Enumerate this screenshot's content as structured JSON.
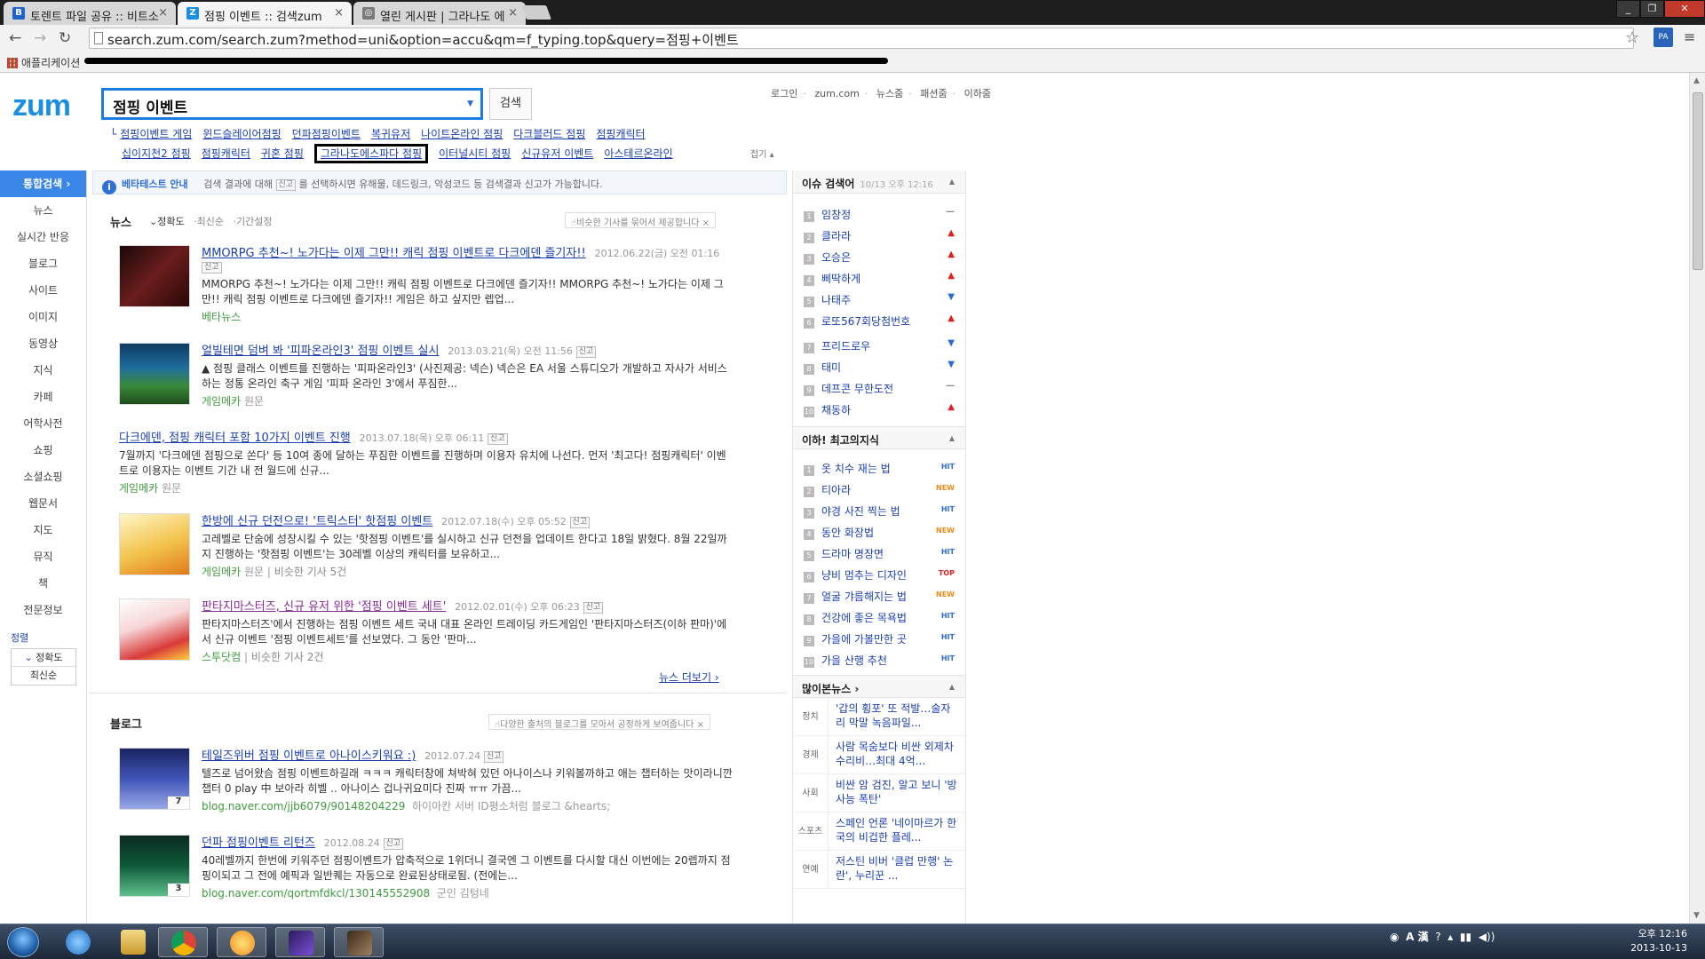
{
  "browser": {
    "tabs": [
      {
        "label": "토렌트 파일 공유 :: 비트소",
        "fav": "B",
        "color": "#1f64c8"
      },
      {
        "label": "점핑 이벤트 :: 검색zum",
        "fav": "Z",
        "color": "#1a8ee0"
      },
      {
        "label": "열린 게시판 | 그라나도 에",
        "fav": "◎",
        "color": "#7a7a7a"
      }
    ],
    "url": "search.zum.com/search.zum?method=uni&option=accu&qm=f_typing.top&query=점핑+이벤트",
    "bookmarks_apps": "애플리케이션",
    "ext_label": "PA"
  },
  "header": {
    "logo": "zum",
    "query": "점핑 이벤트",
    "search_button": "검색",
    "top_links": [
      "로그인",
      "zum.com",
      "뉴스줌",
      "패션줌",
      "이하줌"
    ]
  },
  "related": {
    "row1": [
      "점핑이벤트 게임",
      "윈드슬레이어점핑",
      "던파점핑이벤트",
      "복귀유저",
      "나이트온라인 점핑",
      "다크블러드 점핑",
      "점핑캐릭터"
    ],
    "row2": [
      "십이지천2 점핑",
      "점핑캐릭터",
      "귀혼 점핑",
      "그라나도에스파다 점핑",
      "이터널시티 점핑",
      "신규유저 이벤트",
      "아스테르온라인"
    ],
    "fold": "접기 ▴"
  },
  "leftnav": {
    "items": [
      "통합검색",
      "뉴스",
      "실시간 반응",
      "블로그",
      "사이트",
      "이미지",
      "동영상",
      "지식",
      "카페",
      "어학사전",
      "쇼핑",
      "소셜쇼핑",
      "웹문서",
      "지도",
      "뮤직",
      "책",
      "전문정보"
    ],
    "sort_title": "정렬",
    "sort_options": [
      "정확도",
      "최신순"
    ]
  },
  "notice": {
    "title": "베타테스트 안내",
    "text_before": "검색 결과에 대해",
    "tag": "신고",
    "text_after": "를 선택하시면 유해물, 데드링크, 악성코드 등 검색결과 신고가 가능합니다."
  },
  "news": {
    "heading": "뉴스",
    "sort": [
      "정확도",
      "최신순",
      "기간설정"
    ],
    "tip": "비슷한 기사를 묶어서 제공합니다",
    "more": "뉴스 더보기 ›",
    "items": [
      {
        "title": "MMORPG 추천~! 노가다는 이제 그만!! 캐릭 점핑 이벤트로 다크에덴 즐기자!!",
        "date": "2012.06.22(금) 오전 01:16",
        "tag": "신고",
        "desc": "MMORPG 추천~! 노가다는 이제 그만!! 캐릭 점핑 이벤트로 다크에덴 즐기자!! MMORPG 추천~! 노가다는 이제 그만!! 캐릭 점핑 이벤트로 다크에덴 즐기자!! 게임은 하고 싶지만 렙업...",
        "source": "베타뉴스",
        "extra": "",
        "similar": "",
        "thumb": "#5a1a1a",
        "visited": false
      },
      {
        "title": "얼빌테면 덤벼 봐 '피파온라인3' 점핑 이벤트 실시",
        "date": "2013.03.21(목) 오전 11:56",
        "tag": "신고",
        "desc": "▲ 점핑 클래스 이벤트를 진행하는 '피파온라인3' (사진제공: 넥슨) 넥슨은 EA 서울 스튜디오가 개발하고 자사가 서비스하는 정통 온라인 축구 게임 '피파 온라인 3'에서 푸짐한...",
        "source": "게임메카",
        "extra": "원문",
        "similar": "",
        "thumb": "#1c4f7a",
        "visited": false
      },
      {
        "title": "다크에덴, 점핑 캐릭터 포함 10가지 이벤트 진행",
        "date": "2013.07.18(목) 오후 06:11",
        "tag": "신고",
        "desc": "7월까지 '다크에덴 점핑으로 쏜다' 등 10여 종에 달하는 푸짐한 이벤트를 진행하며 이용자 유치에 나선다. 먼저 '최고다! 점핑캐릭터' 이벤트로 이용자는 이벤트 기간 내 전 월드에 신규...",
        "source": "게임메카",
        "extra": "원문",
        "similar": "",
        "thumb": "",
        "visited": false
      },
      {
        "title": "한방에 신규 던전으로! '트릭스터' 핫점핑 이벤트",
        "date": "2012.07.18(수) 오후 05:52",
        "tag": "신고",
        "desc": "고레벨로 단숨에 성장시킬 수 있는 '핫점핑 이벤트'를 실시하고 신규 던전을 업데이트 한다고 18일 밝혔다. 8월 22일까지 진행하는 '핫점핑 이벤트'는 30레벨 이상의 캐릭터를 보유하고...",
        "source": "게임메카",
        "extra": "원문",
        "similar": "비슷한 기사 5건",
        "thumb": "#f2c24a",
        "visited": false
      },
      {
        "title": "판타지마스터즈, 신규 유저 위한 '점핑 이벤트 세트'",
        "date": "2012.02.01(수) 오후 06:23",
        "tag": "신고",
        "desc": "판타지마스터즈'에서 진행하는 점핑 이벤트 세트 국내 대표 온라인 트레이딩 카드게임인 '판타지마스터즈(이하 판마)'에서 신규 이벤트 '점핑 이벤트세트'를 선보였다. 그 동안 '판마...",
        "source": "스투닷컴",
        "extra": "",
        "similar": "비슷한 기사 2건",
        "thumb": "#d93a3a",
        "visited": true
      }
    ]
  },
  "blog": {
    "heading": "블로그",
    "tip": "다양한 출처의 블로그를 모아서 공정하게 보여줍니다",
    "items": [
      {
        "title": "테일즈위버 점핑 이벤트로 아나이스키워요 :)",
        "date": "2012.07.24",
        "tag": "신고",
        "desc": "텔즈로 넘어왔슴 점핑 이벤트하길래 ㅋㅋㅋ 캐릭터창에 쳐박혀 있던 아나이스나 키워볼까하고 애는 챕터하는 맛이라니깐 챕터 0 play 中 보아라 히벨 .. 아나이스 겁나귀요미다 진짜 ㅠㅠ 가끔...",
        "source": "blog.naver.com/jjb6079/90148204229",
        "author": "하이아칸 서버 ID평소처럼 블로그 &hearts;",
        "count": "7",
        "thumb": "#2c3e8c"
      },
      {
        "title": "던파 점핑이벤트 리턴즈",
        "date": "2012.08.24",
        "tag": "신고",
        "desc": "40레벨까지 한번에 키워주던 점핑이벤트가 압축적으로 1위더니 결국엔 그 이벤트를 다시할 대신 이번에는 20렙까지 점핑이되고 그 전에 예픽과 일반퀘는 자동으로 완료된상태로됨. (전에는...",
        "source": "blog.naver.com/qortmfdkcl/130145552908",
        "author": "군인 김텅네",
        "count": "3",
        "thumb": "#0e5a3a"
      }
    ]
  },
  "issue": {
    "title": "이슈 검색어",
    "time": "10/13 오후 12:16",
    "items": [
      {
        "label": "임창정",
        "state": "same"
      },
      {
        "label": "클라라",
        "state": "up"
      },
      {
        "label": "오승은",
        "state": "up"
      },
      {
        "label": "삐딱하게",
        "state": "up"
      },
      {
        "label": "나태주",
        "state": "down"
      },
      {
        "label": "로또567회당첨번호",
        "state": "up"
      },
      {
        "label": "프리드로우",
        "state": "down"
      },
      {
        "label": "태미",
        "state": "down"
      },
      {
        "label": "데프콘 무한도전",
        "state": "same"
      },
      {
        "label": "채동하",
        "state": "up"
      }
    ],
    "arrows": {
      "up": "▲",
      "down": "▼",
      "same": "—"
    }
  },
  "knowledge": {
    "title": "이하! 최고의지식",
    "items": [
      {
        "label": "옷 치수 재는 법",
        "badge": "HIT"
      },
      {
        "label": "티아라",
        "badge": "NEW"
      },
      {
        "label": "야경 사진 찍는 법",
        "badge": "HIT"
      },
      {
        "label": "동안 화장법",
        "badge": "NEW"
      },
      {
        "label": "드라마 명장면",
        "badge": "HIT"
      },
      {
        "label": "냥비 멈추는 디자인",
        "badge": "TOP"
      },
      {
        "label": "얼굴 갸름해지는 법",
        "badge": "NEW"
      },
      {
        "label": "건강에 좋은 목욕법",
        "badge": "HIT"
      },
      {
        "label": "가을에 가볼만한 곳",
        "badge": "HIT"
      },
      {
        "label": "가을 산행 추천",
        "badge": "HIT"
      }
    ]
  },
  "mostviewed": {
    "title": "많이본뉴스 ›",
    "items": [
      {
        "cat": "정치",
        "text": "'갑의 횡포' 또 적발…술자리 막말 녹음파일..."
      },
      {
        "cat": "경제",
        "text": "사람 목숨보다 비싼 외제차 수리비…최대 4억..."
      },
      {
        "cat": "사회",
        "text": "비싼 암 검진, 알고 보니 '방사능 폭탄'"
      },
      {
        "cat": "스포츠",
        "text": "스페인 언론 '네이마르가 한국의 비겁한 플레..."
      },
      {
        "cat": "연예",
        "text": "저스틴 비버 '클럽 만행' 논란', 누리꾼 ..."
      }
    ]
  },
  "taskbar": {
    "time": "오후 12:16",
    "date": "2013-10-13"
  }
}
